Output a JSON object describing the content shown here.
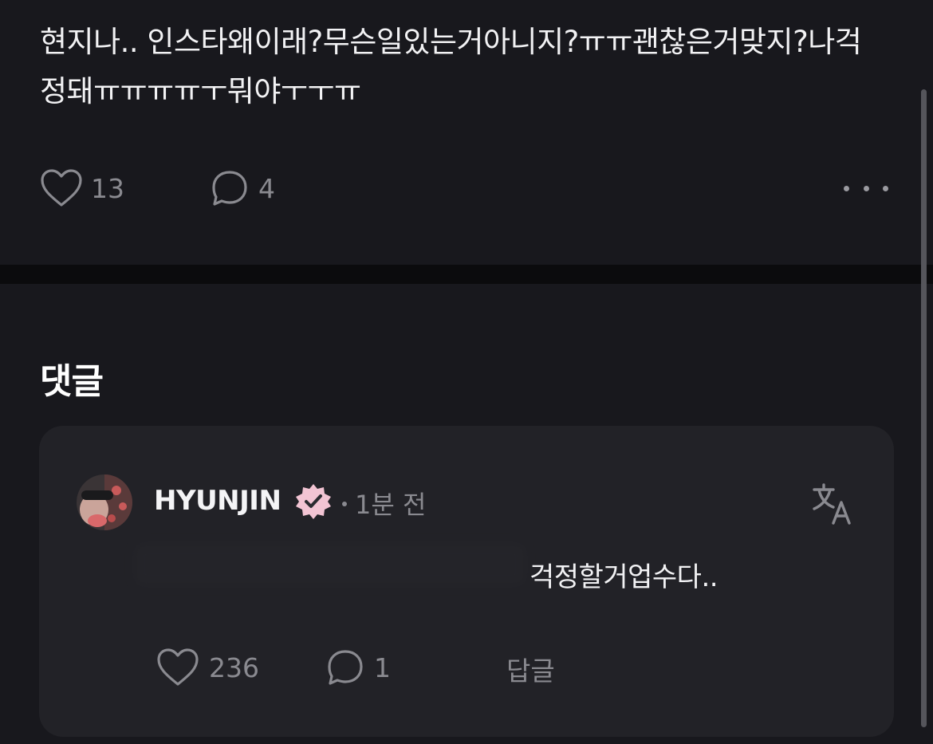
{
  "post": {
    "text": "현지나.. 인스타왜이래?무슨일있는거아니지?ㅠㅠ괜찮은거맞지?나걱정돼ㅠㅠㅠㅠㅜ뭐야ㅜㅜㅠ",
    "like_count": "13",
    "comment_count": "4",
    "like_icon": "heart-icon",
    "comment_icon": "speech-bubble-icon",
    "more_icon": "more-horizontal-icon"
  },
  "comments": {
    "title": "댓글",
    "item": {
      "username": "HYUNJIN",
      "verified_icon": "verified-badge-icon",
      "badge_color": "#f2c4d3",
      "time": "1분 전",
      "text": "걱정할거업수다..",
      "like_count": "236",
      "reply_count": "1",
      "reply_label": "답글",
      "translate_icon": "translate-icon"
    }
  },
  "colors": {
    "background": "#18181d",
    "card": "#222227",
    "text_primary": "#f2f2f4",
    "text_secondary": "#8a8a90"
  }
}
